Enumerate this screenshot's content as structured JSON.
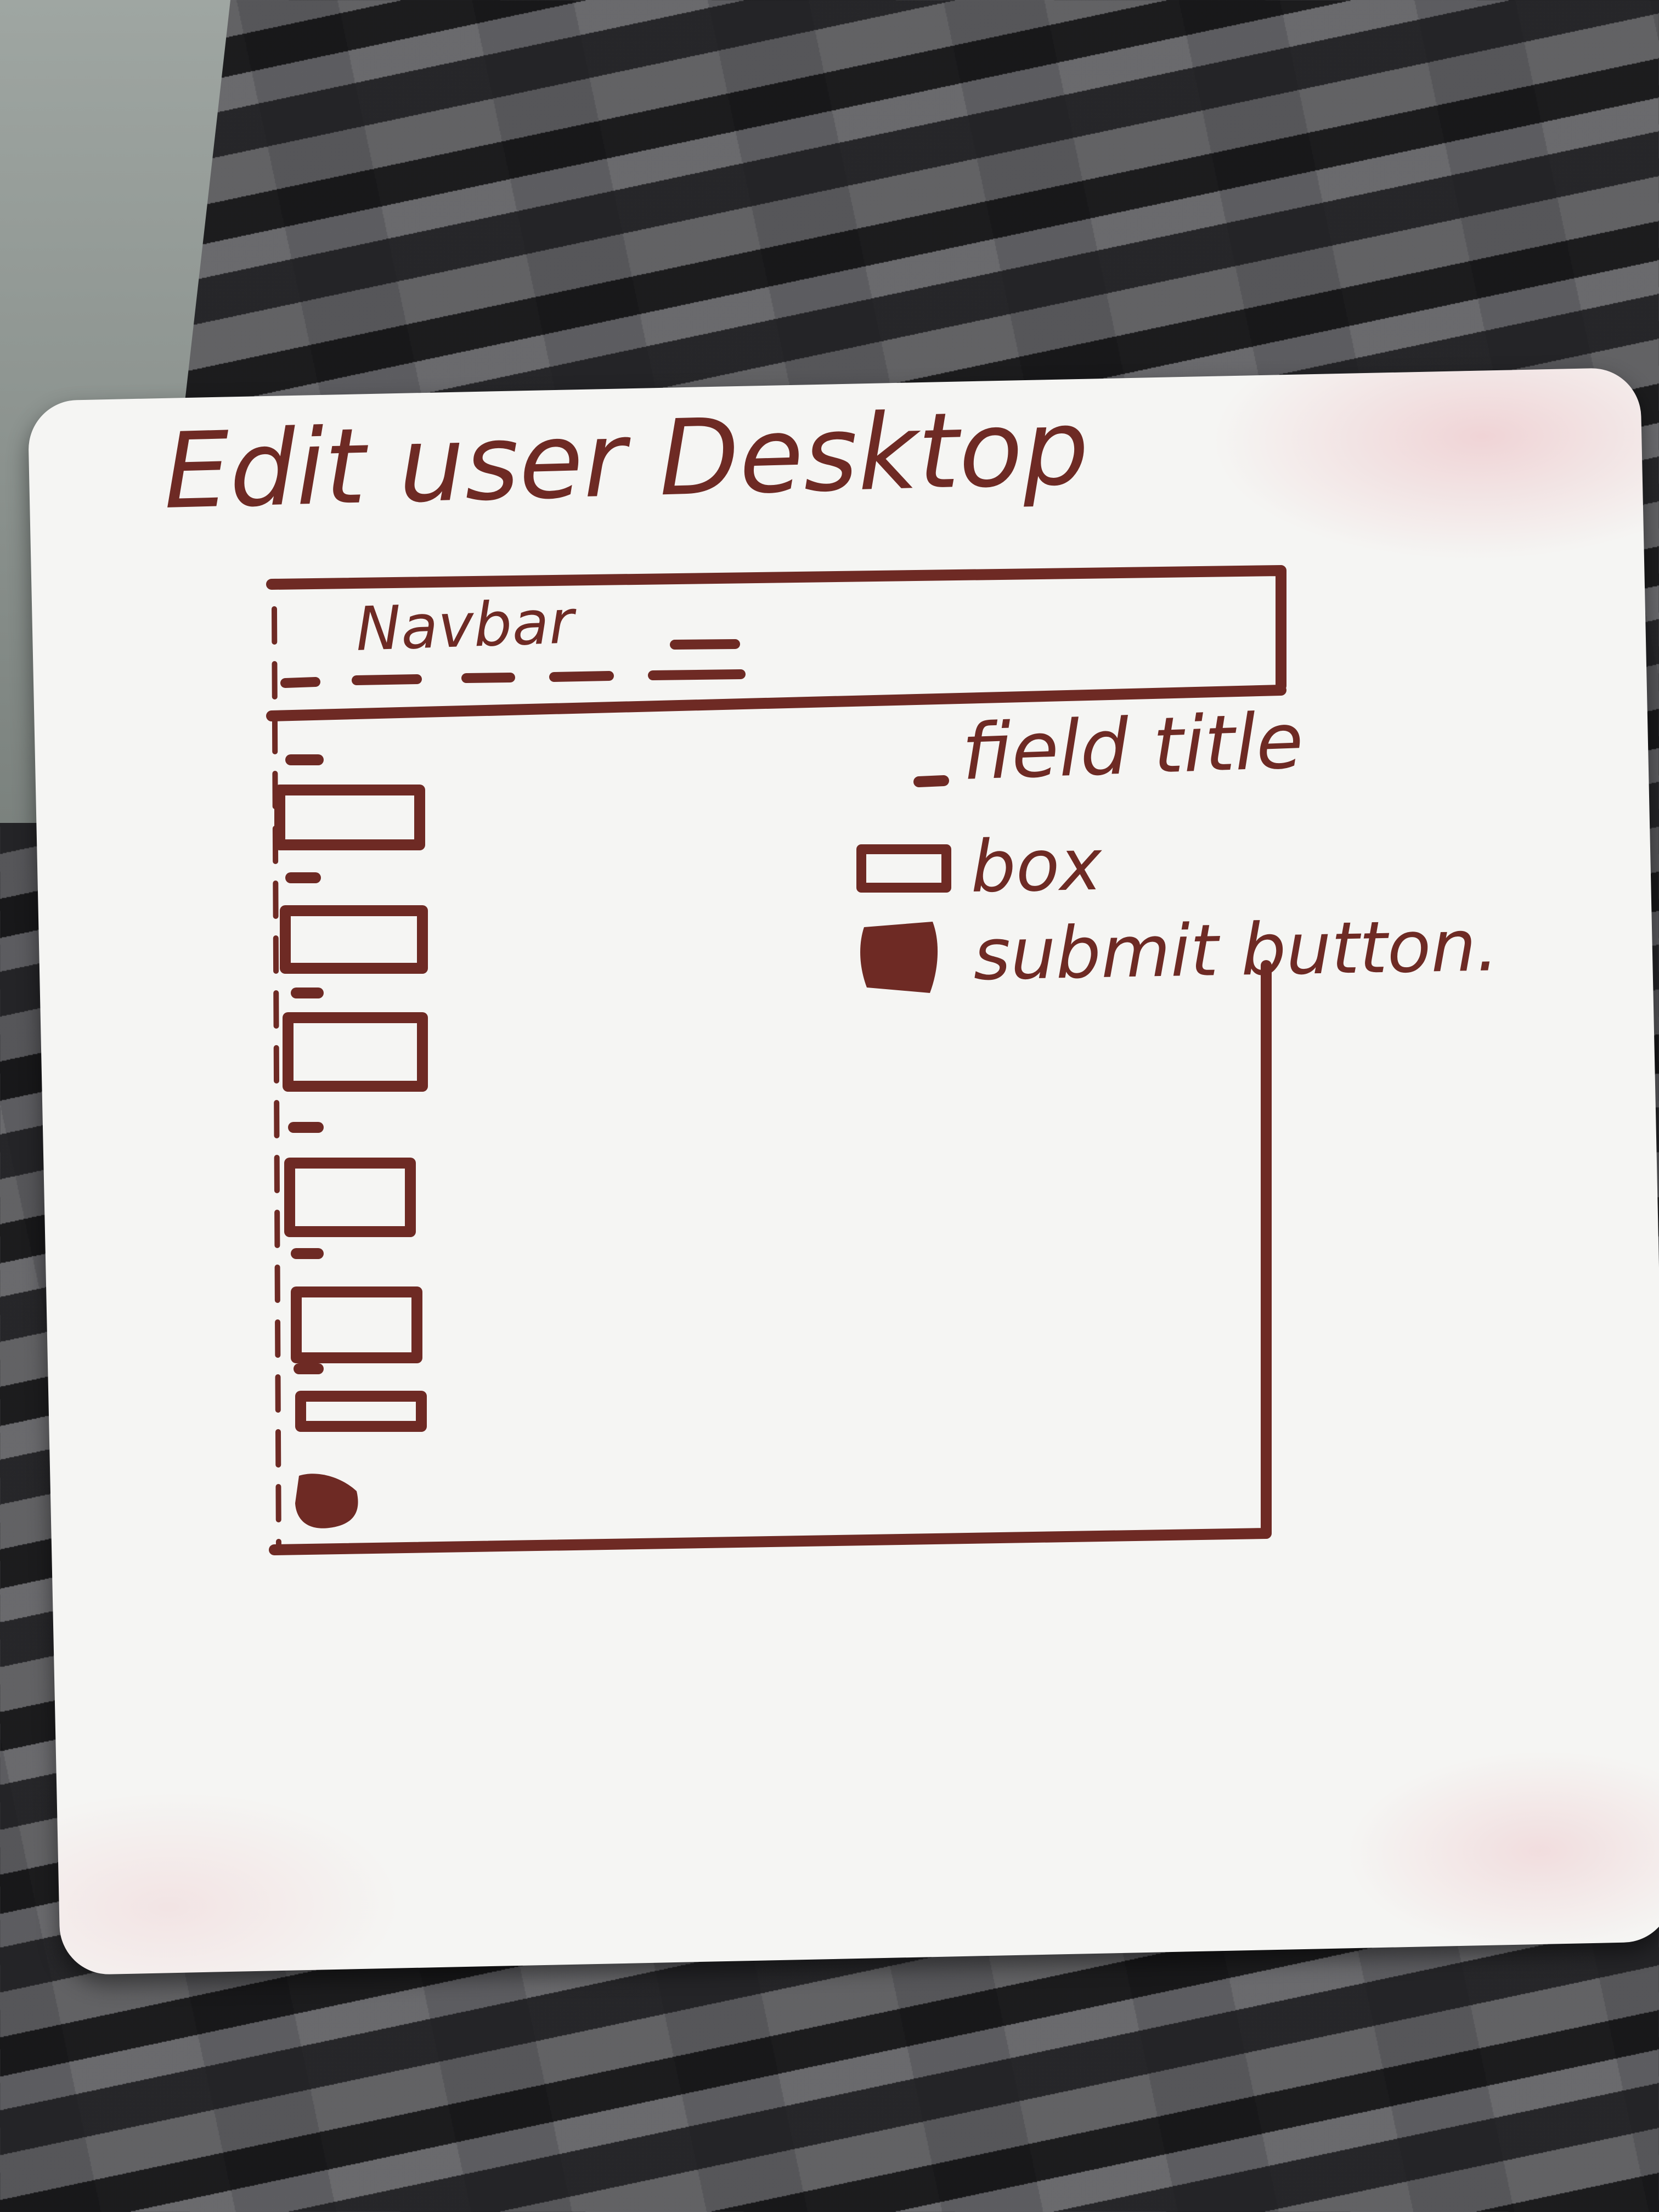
{
  "title": "Edit user Desktop",
  "navbar_label": "Navbar",
  "legend": {
    "field_title": "field title",
    "box": "box",
    "submit_button": "submit button."
  },
  "form_field_count": 7,
  "colors": {
    "ink": "#6e2a24",
    "board": "#f5f5f3",
    "carpet": "#3b3b3d"
  }
}
